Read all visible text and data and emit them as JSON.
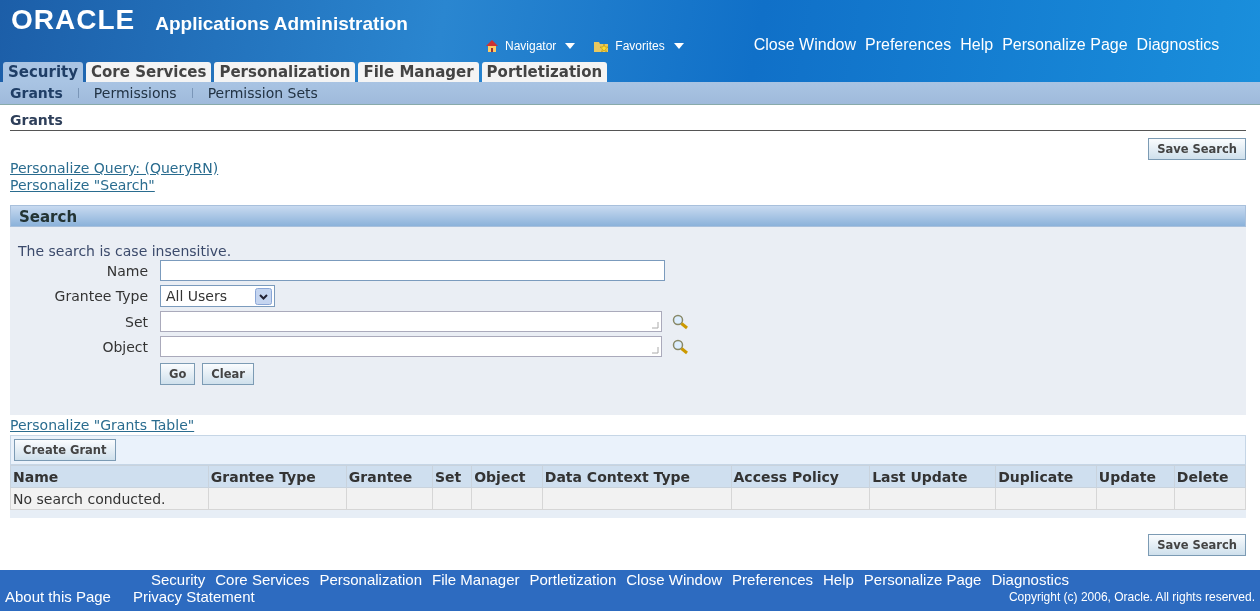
{
  "header": {
    "logo": "ORACLE",
    "title": "Applications Administration",
    "menus": [
      {
        "label": "Navigator",
        "kind": "home"
      },
      {
        "label": "Favorites",
        "kind": "folder"
      }
    ],
    "global_links": [
      "Close Window",
      "Preferences",
      "Help",
      "Personalize Page",
      "Diagnostics"
    ]
  },
  "tabs": [
    {
      "label": "Security",
      "selected": true
    },
    {
      "label": "Core Services",
      "selected": false
    },
    {
      "label": "Personalization",
      "selected": false
    },
    {
      "label": "File Manager",
      "selected": false
    },
    {
      "label": "Portletization",
      "selected": false
    }
  ],
  "subtabs": [
    {
      "label": "Grants",
      "selected": true
    },
    {
      "label": "Permissions",
      "selected": false
    },
    {
      "label": "Permission Sets",
      "selected": false
    }
  ],
  "page_title": "Grants",
  "save_search_button": "Save Search",
  "personalize_links": [
    "Personalize Query: (QueryRN)",
    "Personalize \"Search\""
  ],
  "search": {
    "title": "Search",
    "hint": "The search is case insensitive.",
    "fields": [
      {
        "label": "Name",
        "kind": "text"
      },
      {
        "label": "Grantee Type",
        "kind": "select",
        "value": "All Users"
      },
      {
        "label": "Set",
        "kind": "lov"
      },
      {
        "label": "Object",
        "kind": "lov"
      }
    ],
    "buttons": [
      "Go",
      "Clear"
    ]
  },
  "table": {
    "personalize_link": "Personalize \"Grants Table\"",
    "create_button": "Create Grant",
    "columns": [
      "Name",
      "Grantee Type",
      "Grantee",
      "Set",
      "Object",
      "Data Context Type",
      "Access Policy",
      "Last Update",
      "Duplicate",
      "Update",
      "Delete"
    ],
    "empty_message": "No search conducted."
  },
  "bottom_save_search_button": "Save Search",
  "footer": {
    "links": [
      "Security",
      "Core Services",
      "Personalization",
      "File Manager",
      "Portletization",
      "Close Window",
      "Preferences",
      "Help",
      "Personalize Page",
      "Diagnostics"
    ],
    "about_links": [
      "About this Page",
      "Privacy Statement"
    ],
    "copyright": "Copyright (c) 2006, Oracle. All rights reserved."
  }
}
